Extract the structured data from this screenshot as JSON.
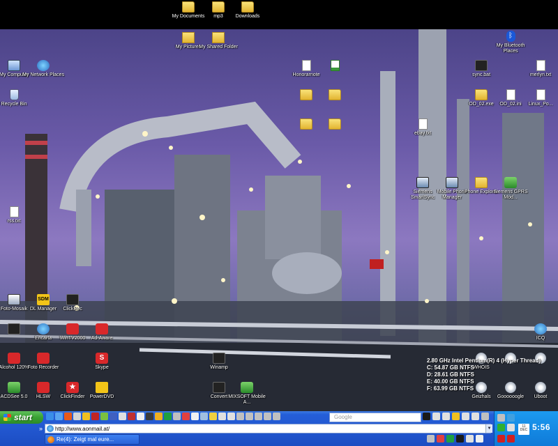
{
  "desktop": {
    "icons": {
      "my_documents": "My Documents",
      "mp3": "mp3",
      "downloads": "Downloads",
      "my_pictures": "My Pictures",
      "my_shared_folder": "My Shared Folder",
      "my_bluetooth_places": "My Bluetooth Places",
      "my_computer": "My Computer",
      "my_network_places": "My Network Places",
      "recycle_bin": "Recycle Bin",
      "honorarnote": "Honorarnote",
      "sync_bat": "sync.bat",
      "merlyn_txt": "merlyn.txt",
      "od_02_exe": "OD_02.exe",
      "od_02_ini": "OD_02.ini",
      "linux_po": "Linux_Po...",
      "ebay_txt": "ebay.txt",
      "siemens_smartsync": "Siemens SmartSync",
      "mobile_phone_manager": "Mobile Phone Manager",
      "phone_explorer": "Phone Explorer",
      "siemens_gprs": "Siemens GPRS Mod...",
      "rss_txt": "rss.txt",
      "foto_mosaik": "Foto-Mosaik",
      "dl_manager": "DL Manager",
      "clickrec": "ClickRec",
      "encarta": "Encarta",
      "wintv2000": "WinTV2000",
      "ad_aware": "Ad-Aware",
      "alcohol": "Alcohol 120%",
      "foto_recorder": "Foto Recorder",
      "skype": "Skype",
      "acdsee": "ACDSee 5.0",
      "hlsw": "HLSW",
      "clickfinder": "ClickFinder",
      "powerdvd": "PowerDVD",
      "winamp": "Winamp",
      "convert": "Convert",
      "mixsoft": "MIXSOFT Mobile A...",
      "whois": "WHOIS",
      "geizhals": "Geizhals",
      "gooooogle": "Goooooogle",
      "uboot": "Uboot",
      "icq": "ICQ"
    }
  },
  "sysinfo": {
    "line1": "2.80 GHz Intel Pentium(R) 4 (Hyper Thread)",
    "line2": "C: 54.87 GB NTFS",
    "line3": "D: 28.61 GB NTFS",
    "line4": "E: 40.00 GB NTFS",
    "line5": "F: 63.99 GB NTFS"
  },
  "taskbar": {
    "start_label": "start",
    "google_placeholder": "Google",
    "address_value": "http://www.aonmail.at/",
    "task_item": "Re(4): Zeigt mal eure...",
    "calendar_day": "11",
    "calendar_month": "DEC",
    "clock": "5:56"
  },
  "colors": {
    "taskbar_blue": "#245ed8",
    "start_green": "#39a233",
    "tray_blue": "#0f7ad8"
  }
}
